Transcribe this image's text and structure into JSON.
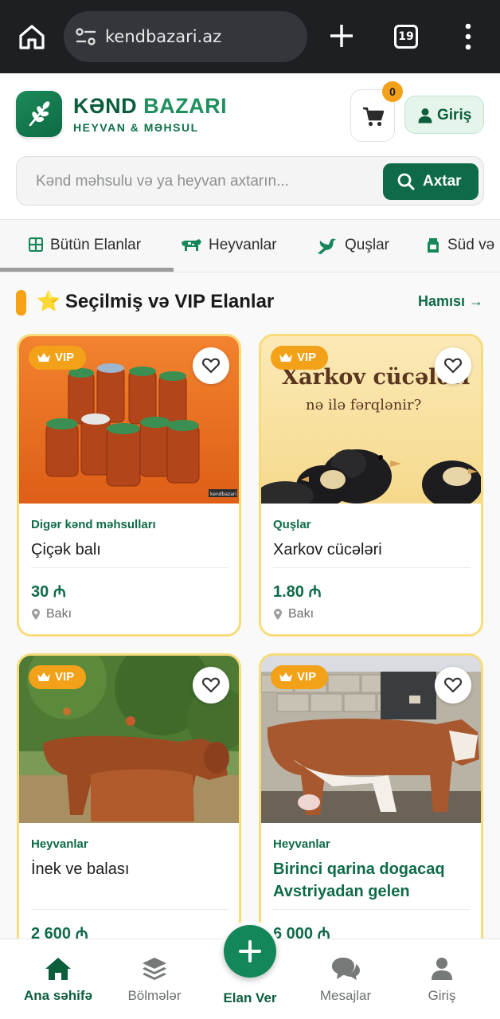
{
  "browser": {
    "url": "kendbazari.az",
    "tab_count": "19"
  },
  "header": {
    "brand_part1": "KƏND",
    "brand_part2": "BAZARI",
    "tagline": "HEYVAN & MƏHSUL",
    "cart_count": "0",
    "login_label": "Giriş",
    "search_placeholder": "Kənd məhsulu və ya heyvan axtarın...",
    "search_button": "Axtar"
  },
  "categories": [
    {
      "label": "Bütün Elanlar",
      "icon": "grid-icon",
      "active": true
    },
    {
      "label": "Heyvanlar",
      "icon": "cow-icon"
    },
    {
      "label": "Quşlar",
      "icon": "bird-icon"
    },
    {
      "label": "Süd və",
      "icon": "milk-icon"
    }
  ],
  "section": {
    "title": "Seçilmiş və VIP Elanlar",
    "star": "⭐",
    "all_link": "Hamısı →"
  },
  "listings": [
    {
      "vip": "VIP",
      "category": "Digər kənd məhsulları",
      "title": "Çiçək balı",
      "price": "30 ₼",
      "location": "Bakı",
      "image": "honey-jars",
      "watermark": "kendbazari"
    },
    {
      "vip": "VIP",
      "category": "Quşlar",
      "title": "Xarkov cücələri",
      "price": "1.80 ₼",
      "location": "Bakı",
      "image": "chicks",
      "image_text1": "Xarkov cücələri",
      "image_text2": "nə ilə fərqlənir?"
    },
    {
      "vip": "VIP",
      "category": "Heyvanlar",
      "title": "İnek ve balası",
      "price": "2 600 ₼",
      "location": "",
      "image": "cow-and-calf"
    },
    {
      "vip": "VIP",
      "category": "Heyvanlar",
      "title": "Birinci qarina dogacaq Avstriyadan gelen ineyin…",
      "price": "6 000 ₼",
      "location": "",
      "image": "cow-barn"
    }
  ],
  "bottom_nav": {
    "home": "Ana səhifə",
    "sections": "Bölmələr",
    "post_ad": "Elan Ver",
    "messages": "Mesajlar",
    "login": "Giriş"
  },
  "colors": {
    "brand_green": "#0f6b47",
    "vip_orange": "#f2a118",
    "card_border": "#f7dc7c"
  }
}
